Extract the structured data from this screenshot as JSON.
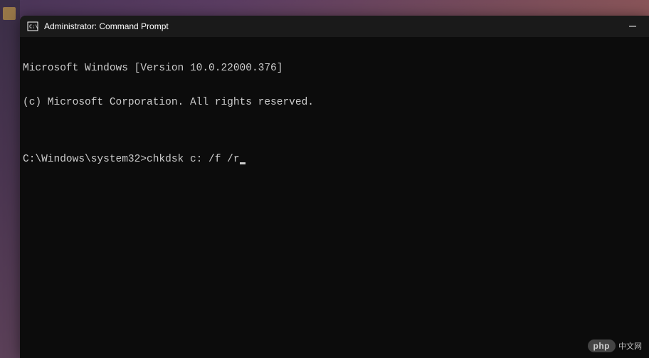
{
  "window": {
    "title": "Administrator: Command Prompt"
  },
  "terminal": {
    "line1": "Microsoft Windows [Version 10.0.22000.376]",
    "line2": "(c) Microsoft Corporation. All rights reserved.",
    "blank1": "",
    "prompt": "C:\\Windows\\system32>",
    "command": "chkdsk c: /f /r"
  },
  "watermark": {
    "badge": "php",
    "text": "中文网"
  }
}
